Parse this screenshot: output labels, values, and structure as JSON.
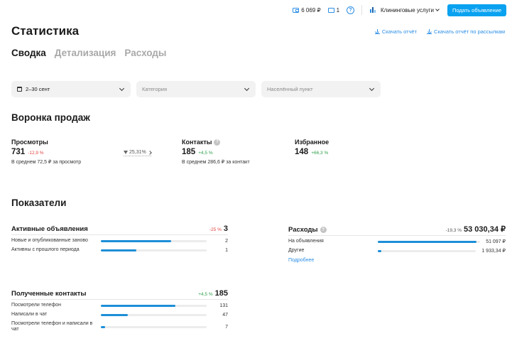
{
  "topbar": {
    "balance": "6 069 ₽",
    "messages": "1",
    "help_symbol": "?",
    "category": "Клининговые услуги",
    "post_button": "Подать объявление"
  },
  "page": {
    "title": "Статистика",
    "download_report": "Скачать отчёт",
    "download_mailing": "Скачать отчёт по рассылкам"
  },
  "tabs": [
    "Сводка",
    "Детализация",
    "Расходы"
  ],
  "filters": {
    "period": "2–30 сент",
    "category_placeholder": "Категория",
    "location_placeholder": "Населённый пункт"
  },
  "funnel": {
    "title": "Воронка продаж",
    "views": {
      "label": "Просмотры",
      "value": "731",
      "change": "-12,9 %",
      "sub": "В среднем 72,5 ₽ за просмотр"
    },
    "conversion": "25,31%",
    "contacts": {
      "label": "Контакты",
      "value": "185",
      "change": "+4,5 %",
      "sub": "В среднем 286,6 ₽ за контакт"
    },
    "favorites": {
      "label": "Избранное",
      "value": "148",
      "change": "+66,3 %"
    }
  },
  "indicators": {
    "title": "Показатели",
    "active_ads": {
      "title": "Активные объявления",
      "change": "-25 %",
      "total": "3",
      "rows": [
        {
          "label": "Новые и опубликованные заново",
          "value": "2",
          "fraction": 0.667
        },
        {
          "label": "Активны с прошлого периода",
          "value": "1",
          "fraction": 0.333
        }
      ]
    },
    "expenses": {
      "title": "Расходы",
      "change": "-19,3 %",
      "total": "53 030,34 ₽",
      "rows": [
        {
          "label": "На объявления",
          "value": "51 097 ₽",
          "fraction": 0.964
        },
        {
          "label": "Другие",
          "value": "1 933,34 ₽",
          "fraction": 0.036
        }
      ],
      "more": "Подробнее"
    },
    "contacts": {
      "title": "Полученные контакты",
      "change": "+4,5 %",
      "total": "185",
      "rows": [
        {
          "label": "Посмотрели телефон",
          "value": "131",
          "fraction": 0.708
        },
        {
          "label": "Написали в чат",
          "value": "47",
          "fraction": 0.254
        },
        {
          "label": "Посмотрели телефон и написали в чат",
          "value": "7",
          "fraction": 0.038
        }
      ]
    }
  }
}
